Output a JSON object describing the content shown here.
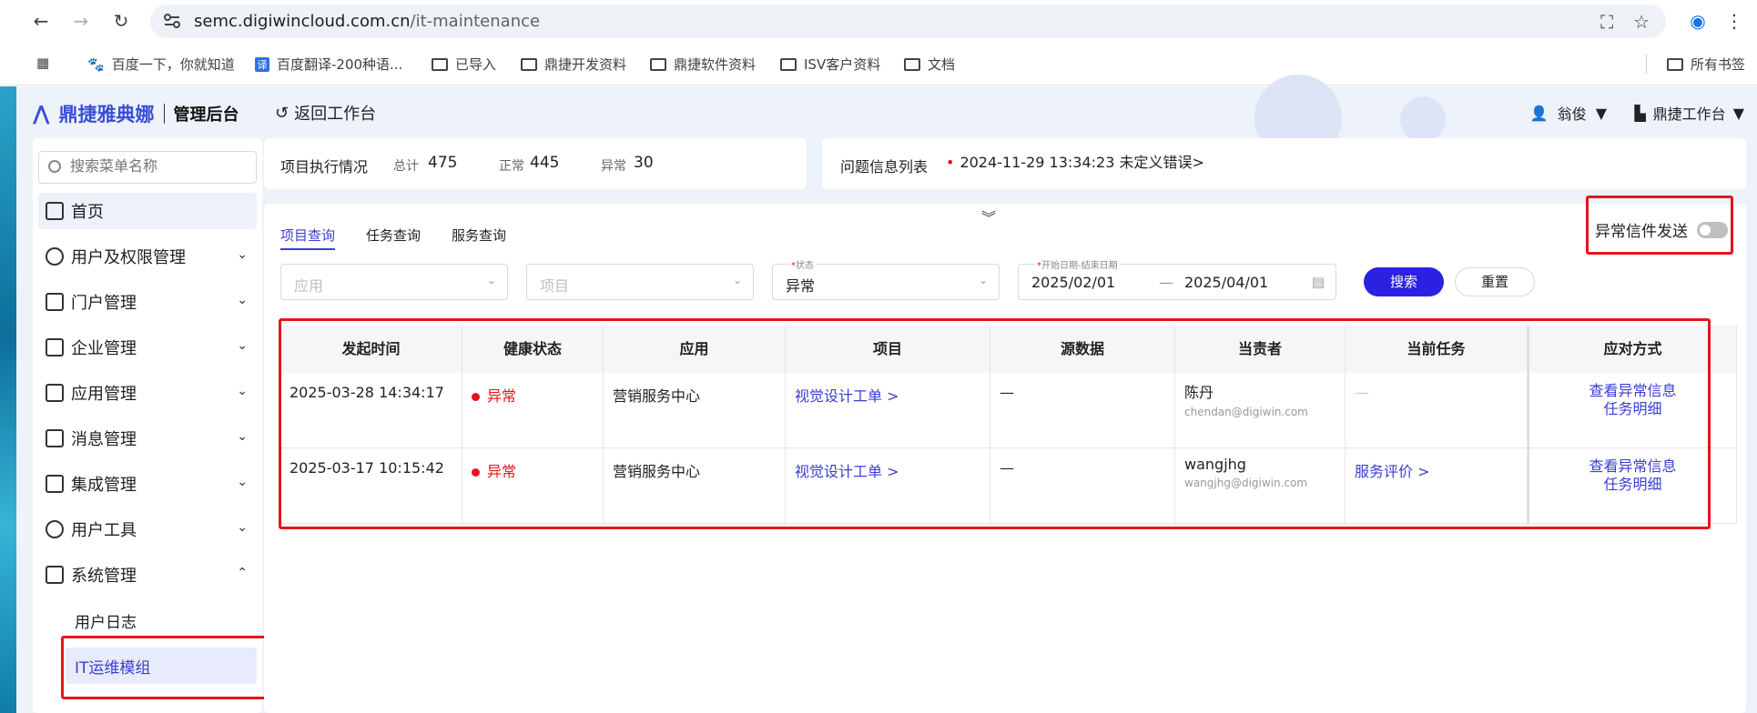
{
  "browser": {
    "url_host": "semc.digiwincloud.com.cn",
    "url_path": "/it-maintenance",
    "bookmarks": [
      "百度一下，你就知道",
      "百度翻译-200种语...",
      "已导入",
      "鼎捷开发资料",
      "鼎捷软件资料",
      "ISV客户资料",
      "文档"
    ],
    "all_bookmarks": "所有书签"
  },
  "header": {
    "brand": "鼎捷雅典娜",
    "title": "管理后台",
    "back": "返回工作台",
    "user": "翁俊",
    "workspace": "鼎捷工作台"
  },
  "sidebar": {
    "search_placeholder": "搜索菜单名称",
    "items": [
      "首页",
      "用户及权限管理",
      "门户管理",
      "企业管理",
      "应用管理",
      "消息管理",
      "集成管理",
      "用户工具",
      "系统管理"
    ],
    "sub_items": [
      "用户日志",
      "IT运维模组"
    ]
  },
  "stats": {
    "title": "项目执行情况",
    "total_label": "总计",
    "total": "475",
    "normal_label": "正常",
    "normal": "445",
    "abnormal_label": "异常",
    "abnormal": "30"
  },
  "issues": {
    "title": "问题信息列表",
    "message": "2024-11-29 13:34:23 未定义错误>"
  },
  "tabs": [
    "项目查询",
    "任务查询",
    "服务查询"
  ],
  "toggle_label": "异常信件发送",
  "filters": {
    "app_placeholder": "应用",
    "project_placeholder": "项目",
    "status_label": "状态",
    "status_value": "异常",
    "date_label": "开始日期-结束日期",
    "date_start": "2025/02/01",
    "date_sep": "—",
    "date_end": "2025/04/01",
    "search": "搜索",
    "reset": "重置"
  },
  "table": {
    "headers": [
      "发起时间",
      "健康状态",
      "应用",
      "项目",
      "源数据",
      "当责者",
      "当前任务",
      "应对方式"
    ],
    "rows": [
      {
        "time": "2025-03-28 14:34:17",
        "status": "异常",
        "app": "营销服务中心",
        "project": "视觉设计工单 >",
        "source": "—",
        "owner": "陈丹",
        "email": "chendan@digiwin.com",
        "task": "—",
        "action1": "查看异常信息",
        "action2": "任务明细"
      },
      {
        "time": "2025-03-17 10:15:42",
        "status": "异常",
        "app": "营销服务中心",
        "project": "视觉设计工单 >",
        "source": "—",
        "owner": "wangjhg",
        "email": "wangjhg@digiwin.com",
        "task": "服务评价 >",
        "action1": "查看异常信息",
        "action2": "任务明细"
      }
    ]
  }
}
